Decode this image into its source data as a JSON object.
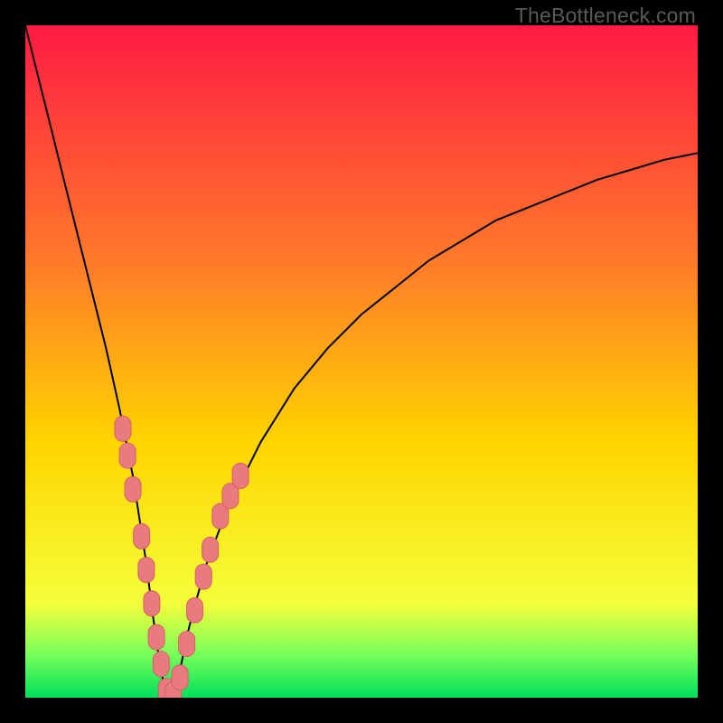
{
  "watermark": "TheBottleneck.com",
  "colors": {
    "bg_black": "#000000",
    "curve": "#000000",
    "marker_fill": "#e77b7f",
    "marker_stroke": "#d85f63",
    "grad_top": "#ff1a44",
    "grad_mid1": "#ff7a2a",
    "grad_mid2": "#ffd400",
    "grad_mid3": "#f4ff3a",
    "grad_green1": "#7aff5a",
    "grad_green2": "#00e05a"
  },
  "chart_data": {
    "type": "line",
    "title": "",
    "xlabel": "",
    "ylabel": "",
    "xlim": [
      0,
      100
    ],
    "ylim": [
      0,
      100
    ],
    "grid": false,
    "legend": false,
    "annotations": [
      "TheBottleneck.com"
    ],
    "series": [
      {
        "name": "bottleneck-curve",
        "x": [
          0,
          2,
          4,
          6,
          8,
          10,
          12,
          14,
          16,
          18,
          19,
          20,
          21,
          22,
          23,
          24,
          25,
          27,
          30,
          35,
          40,
          45,
          50,
          55,
          60,
          65,
          70,
          75,
          80,
          85,
          90,
          95,
          100
        ],
        "y": [
          100,
          92,
          84,
          76,
          68,
          60,
          52,
          43,
          33,
          20,
          12,
          5,
          0,
          0,
          4,
          9,
          13,
          20,
          28,
          38,
          46,
          52,
          57,
          61,
          65,
          68,
          71,
          73,
          75,
          77,
          78.5,
          80,
          81
        ]
      }
    ],
    "markers": {
      "name": "highlighted-points",
      "points": [
        {
          "x": 14.5,
          "y": 40
        },
        {
          "x": 15.2,
          "y": 36
        },
        {
          "x": 16.0,
          "y": 31
        },
        {
          "x": 17.3,
          "y": 24
        },
        {
          "x": 18.0,
          "y": 19
        },
        {
          "x": 18.8,
          "y": 14
        },
        {
          "x": 19.5,
          "y": 9
        },
        {
          "x": 20.2,
          "y": 5
        },
        {
          "x": 21.0,
          "y": 1
        },
        {
          "x": 22.0,
          "y": 0.5
        },
        {
          "x": 23.0,
          "y": 3
        },
        {
          "x": 24.0,
          "y": 8
        },
        {
          "x": 25.2,
          "y": 13
        },
        {
          "x": 26.5,
          "y": 18
        },
        {
          "x": 27.5,
          "y": 22
        },
        {
          "x": 29.0,
          "y": 27
        },
        {
          "x": 30.5,
          "y": 30
        },
        {
          "x": 32.0,
          "y": 33
        }
      ]
    },
    "gradient_bands": [
      {
        "y_from": 100,
        "y_to": 12,
        "from_color": "#ff1a44",
        "to_color": "#f4ff3a"
      },
      {
        "y_from": 12,
        "y_to": 5,
        "from_color": "#f4ff3a",
        "to_color": "#7aff5a"
      },
      {
        "y_from": 5,
        "y_to": 0,
        "from_color": "#7aff5a",
        "to_color": "#00e05a"
      }
    ]
  }
}
